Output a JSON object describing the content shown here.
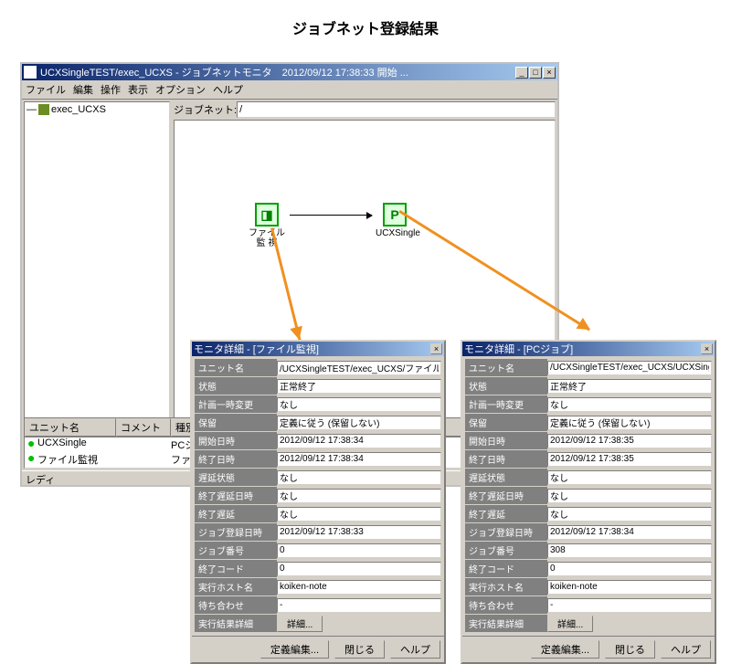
{
  "page_title": "ジョブネット登録結果",
  "main_window": {
    "title": "UCXSingleTEST/exec_UCXS - ジョブネットモニタ　2012/09/12 17:38:33 開始 ...",
    "menubar": [
      "ファイル",
      "編集",
      "操作",
      "表示",
      "オプション",
      "ヘルプ"
    ],
    "tree_root": "exec_UCXS",
    "jobnet_label": "ジョブネット:",
    "jobnet_value": "/",
    "nodes": {
      "file_watch": {
        "label": "ファイル監\n視"
      },
      "ucxsingle": {
        "label": "UCXSingle",
        "glyph": "P"
      }
    },
    "grid_headers": {
      "unit": "ユニット名",
      "comment": "コメント",
      "type": "種別"
    },
    "grid_rows": [
      {
        "unit": "UCXSingle",
        "comment": "",
        "type": "PCジョ"
      },
      {
        "unit": "ファイル監視",
        "comment": "",
        "type": "ファイ"
      }
    ],
    "status": "レディ"
  },
  "dialog_labels": {
    "unit_name": "ユニット名",
    "state": "状態",
    "plan_temp_change": "計画一時変更",
    "hold": "保留",
    "start_time": "開始日時",
    "end_time": "終了日時",
    "delay_state": "遅延状態",
    "end_delay_time": "終了遅延日時",
    "end_delay": "終了遅延",
    "job_reg_time": "ジョブ登録日時",
    "job_num": "ジョブ番号",
    "exit_code": "終了コード",
    "exec_host": "実行ホスト名",
    "wait": "待ち合わせ",
    "result_detail": "実行結果詳細",
    "detail_btn": "詳細...",
    "def_edit": "定義編集...",
    "close": "閉じる",
    "help": "ヘルプ"
  },
  "dialog1": {
    "title": "モニタ詳細 - [ファイル監視]",
    "unit_name": "/UCXSingleTEST/exec_UCXS/ファイル監視",
    "state": "正常終了",
    "plan_temp_change": "なし",
    "hold": "定義に従う (保留しない)",
    "start_time": "2012/09/12 17:38:34",
    "end_time": "2012/09/12 17:38:34",
    "delay_state": "なし",
    "end_delay_time": "なし",
    "end_delay": "なし",
    "job_reg_time": "2012/09/12 17:38:33",
    "job_num": "0",
    "exit_code": "0",
    "exec_host": "koiken-note",
    "wait": "-"
  },
  "dialog2": {
    "title": "モニタ詳細 - [PCジョブ]",
    "unit_name": "/UCXSingleTEST/exec_UCXS/UCXSingle",
    "state": "正常終了",
    "plan_temp_change": "なし",
    "hold": "定義に従う (保留しない)",
    "start_time": "2012/09/12 17:38:35",
    "end_time": "2012/09/12 17:38:35",
    "delay_state": "なし",
    "end_delay_time": "なし",
    "end_delay": "なし",
    "job_reg_time": "2012/09/12 17:38:34",
    "job_num": "308",
    "exit_code": "0",
    "exec_host": "koiken-note",
    "wait": "-"
  }
}
